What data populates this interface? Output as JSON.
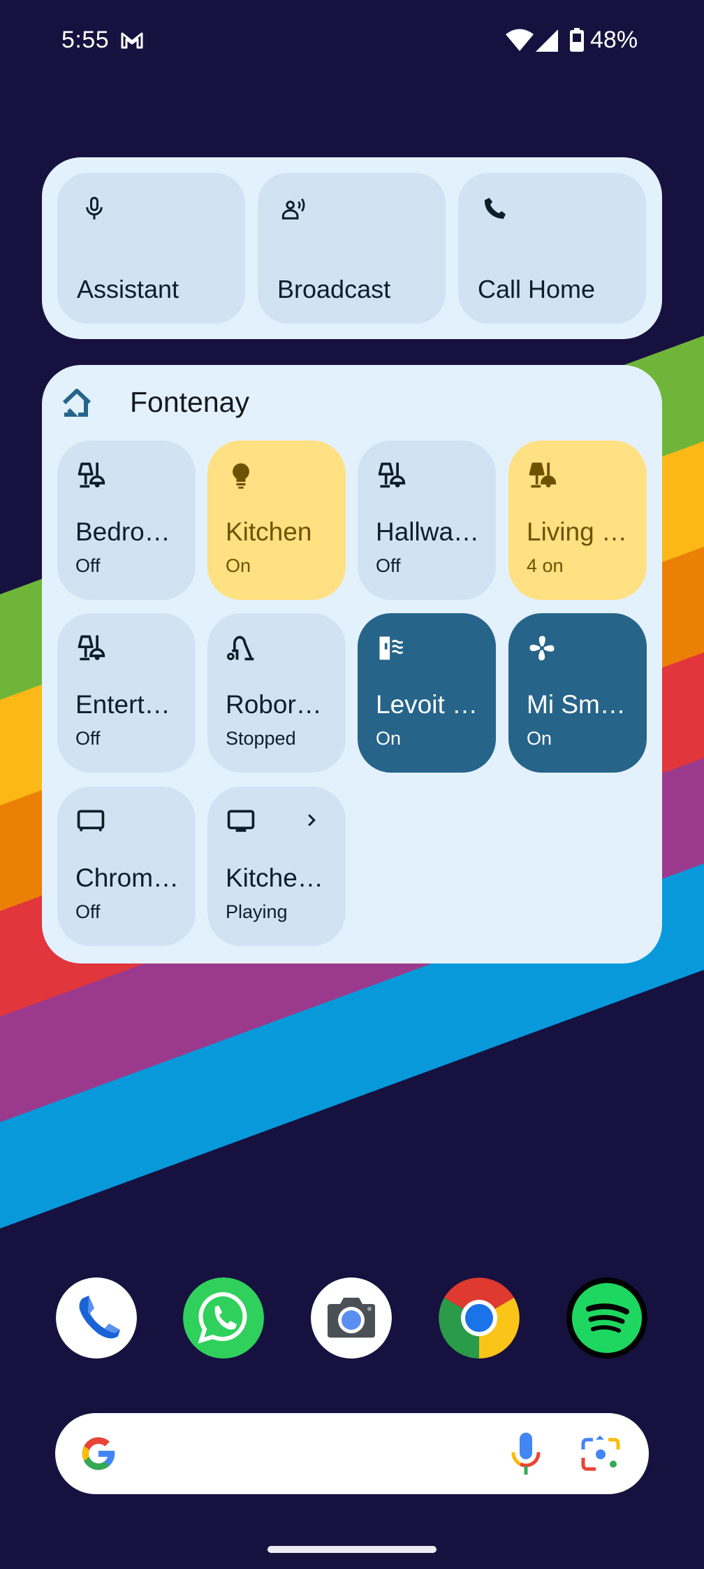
{
  "status_bar": {
    "time": "5:55",
    "notification_icons": [
      "gmail-icon"
    ],
    "system_icons": [
      "wifi-icon",
      "cell-signal-icon",
      "battery-icon"
    ],
    "battery_percent": "48%"
  },
  "wallpaper": {
    "background_color": "#17113f",
    "stripe_colors": [
      "#6fb53a",
      "#fbb817",
      "#ec8006",
      "#e0363c",
      "#9b3a8c",
      "#0899da"
    ]
  },
  "quick_actions": [
    {
      "label": "Assistant",
      "icon": "microphone-icon"
    },
    {
      "label": "Broadcast",
      "icon": "broadcast-person-icon"
    },
    {
      "label": "Call Home",
      "icon": "phone-icon"
    }
  ],
  "home_widget": {
    "title": "Fontenay",
    "icon": "google-home-icon",
    "devices": [
      {
        "name": "Bedro…",
        "status": "Off",
        "icon": "lamp-group-icon",
        "state": "off"
      },
      {
        "name": "Kitchen",
        "status": "On",
        "icon": "lightbulb-icon",
        "state": "on-light"
      },
      {
        "name": "Hallwa…",
        "status": "Off",
        "icon": "lamp-group-icon",
        "state": "off"
      },
      {
        "name": "Living …",
        "status": "4 on",
        "icon": "lamp-group-icon",
        "state": "on-light"
      },
      {
        "name": "Entert…",
        "status": "Off",
        "icon": "lamp-group-icon",
        "state": "off"
      },
      {
        "name": "Robor…",
        "status": "Stopped",
        "icon": "vacuum-icon",
        "state": "off"
      },
      {
        "name": "Levoit …",
        "status": "On",
        "icon": "air-purifier-icon",
        "state": "on-device"
      },
      {
        "name": "Mi Sm…",
        "status": "On",
        "icon": "fan-icon",
        "state": "on-device"
      },
      {
        "name": "Chrom…",
        "status": "Off",
        "icon": "tv-icon",
        "state": "off"
      },
      {
        "name": "Kitche…",
        "status": "Playing",
        "icon": "display-icon",
        "state": "off",
        "has_chevron": true
      }
    ],
    "colors": {
      "card": "#e3f1fd",
      "tile_off": "#d1e3f3",
      "tile_on_light": "#ffe082",
      "tile_on_device": "#276489"
    }
  },
  "dock": [
    {
      "app": "Phone",
      "icon": "phone-app-icon"
    },
    {
      "app": "WhatsApp",
      "icon": "whatsapp-icon"
    },
    {
      "app": "Camera",
      "icon": "camera-icon"
    },
    {
      "app": "Chrome",
      "icon": "chrome-icon"
    },
    {
      "app": "Spotify",
      "icon": "spotify-icon"
    }
  ],
  "search_bar": {
    "placeholder": "",
    "icons": [
      "google-g-icon",
      "voice-search-icon",
      "google-lens-icon"
    ]
  }
}
